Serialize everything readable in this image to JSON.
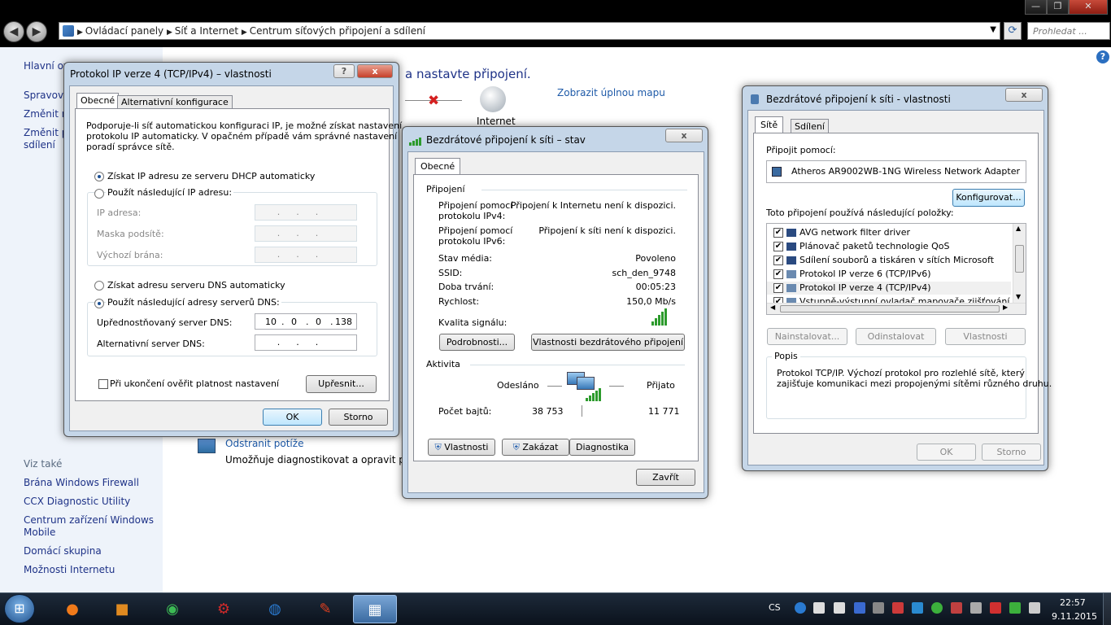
{
  "explorer": {
    "breadcrumb": [
      "Ovládací panely",
      "Síť a Internet",
      "Centrum síťových připojení a sdílení"
    ],
    "search_placeholder": "Prohledat ...",
    "page_heading": "a nastavte připojení.",
    "internet_label": "Internet",
    "full_map_link": "Zobrazit úplnou mapu",
    "troubleshoot_link": "Odstranit potíže",
    "troubleshoot_desc": "Umožňuje diagnostikovat a opravit potíže",
    "left_pane": {
      "top_items": [
        "Hlavní ov",
        "Spravova",
        "Změnit n",
        "Změnit p",
        "sdílení"
      ],
      "see_also": "Viz také",
      "links": [
        "Brána Windows Firewall",
        "CCX Diagnostic Utility",
        "Centrum zařízení Windows",
        "Mobile",
        "Domácí skupina",
        "Možnosti Internetu"
      ]
    }
  },
  "ipv4_dialog": {
    "title": "Protokol IP verze 4 (TCP/IPv4) – vlastnosti",
    "tabs": [
      "Obecné",
      "Alternativní konfigurace"
    ],
    "description": [
      "Podporuje-li síť automatickou konfiguraci IP, je možné získat nastavení",
      "protokolu IP automaticky. V opačném případě vám správné nastavení",
      "poradí správce sítě."
    ],
    "radio_auto_ip": "Získat IP adresu ze serveru DHCP automaticky",
    "radio_manual_ip": "Použít následující IP adresu:",
    "ip_address_label": "IP adresa:",
    "subnet_label": "Maska podsítě:",
    "gateway_label": "Výchozí brána:",
    "radio_auto_dns": "Získat adresu serveru DNS automaticky",
    "radio_manual_dns": "Použít následující adresy serverů DNS:",
    "preferred_dns_label": "Upřednostňovaný server DNS:",
    "preferred_dns_octets": [
      "10",
      "0",
      "0",
      "138"
    ],
    "alternate_dns_label": "Alternativní server DNS:",
    "validate_label": "Při ukončení ověřit platnost nastavení",
    "advanced_button": "Upřesnit...",
    "ok_button": "OK",
    "cancel_button": "Storno",
    "help_glyph": "?",
    "close_glyph": "x"
  },
  "status_dialog": {
    "title": "Bezdrátové připojení k síti – stav",
    "tab": "Obecné",
    "section_connection": "Připojení",
    "ipv4_label": [
      "Připojení pomocí",
      "protokolu IPv4:"
    ],
    "ipv4_value": "Připojení k Internetu není k dispozici.",
    "ipv6_label": [
      "Připojení pomocí",
      "protokolu IPv6:"
    ],
    "ipv6_value": "Připojení k síti není k dispozici.",
    "media_state_label": "Stav média:",
    "media_state_value": "Povoleno",
    "ssid_label": "SSID:",
    "ssid_value": "sch_den_9748",
    "duration_label": "Doba trvání:",
    "duration_value": "00:05:23",
    "speed_label": "Rychlost:",
    "speed_value": "150,0 Mb/s",
    "signal_label": "Kvalita signálu:",
    "signal_strength": 5,
    "details_button": "Podrobnosti...",
    "wireless_props_button": "Vlastnosti bezdrátového připojení",
    "section_activity": "Aktivita",
    "sent_label": "Odesláno",
    "received_label": "Přijato",
    "bytes_label": "Počet bajtů:",
    "bytes_sent": "38 753",
    "bytes_received": "11 771",
    "properties_button": "Vlastnosti",
    "disable_button": "Zakázat",
    "diagnose_button": "Diagnostika",
    "close_button": "Zavřít",
    "close_glyph": "x"
  },
  "props_dialog": {
    "title": "Bezdrátové připojení k síti - vlastnosti",
    "tabs": [
      "Sítě",
      "Sdílení"
    ],
    "connect_using_label": "Připojit pomocí:",
    "adapter_name": "Atheros AR9002WB-1NG Wireless Network Adapter",
    "configure_button": "Konfigurovat...",
    "items_label": "Toto připojení používá následující položky:",
    "items": [
      {
        "label": "AVG network filter driver",
        "checked": true
      },
      {
        "label": "Plánovač paketů technologie QoS",
        "checked": true
      },
      {
        "label": "Sdílení souborů a tiskáren v sítích Microsoft",
        "checked": true
      },
      {
        "label": "Protokol IP verze 6 (TCP/IPv6)",
        "checked": true
      },
      {
        "label": "Protokol IP verze 4 (TCP/IPv4)",
        "checked": true
      },
      {
        "label": "Vstupně-výstupní ovladač mapovače zjišťování topolo",
        "checked": true
      }
    ],
    "install_button": "Nainstalovat...",
    "uninstall_button": "Odinstalovat",
    "properties_button": "Vlastnosti",
    "description_legend": "Popis",
    "description_text": [
      "Protokol TCP/IP. Výchozí protokol pro rozlehlé sítě, který",
      "zajišťuje komunikaci mezi propojenými sítěmi různého druhu."
    ],
    "ok_button": "OK",
    "cancel_button": "Storno",
    "close_glyph": "x"
  },
  "taskbar": {
    "language": "CS",
    "time": "22:57",
    "date": "9.11.2015"
  },
  "window_controls": {
    "minimize": "—",
    "maximize": "❐",
    "close": "✕"
  }
}
